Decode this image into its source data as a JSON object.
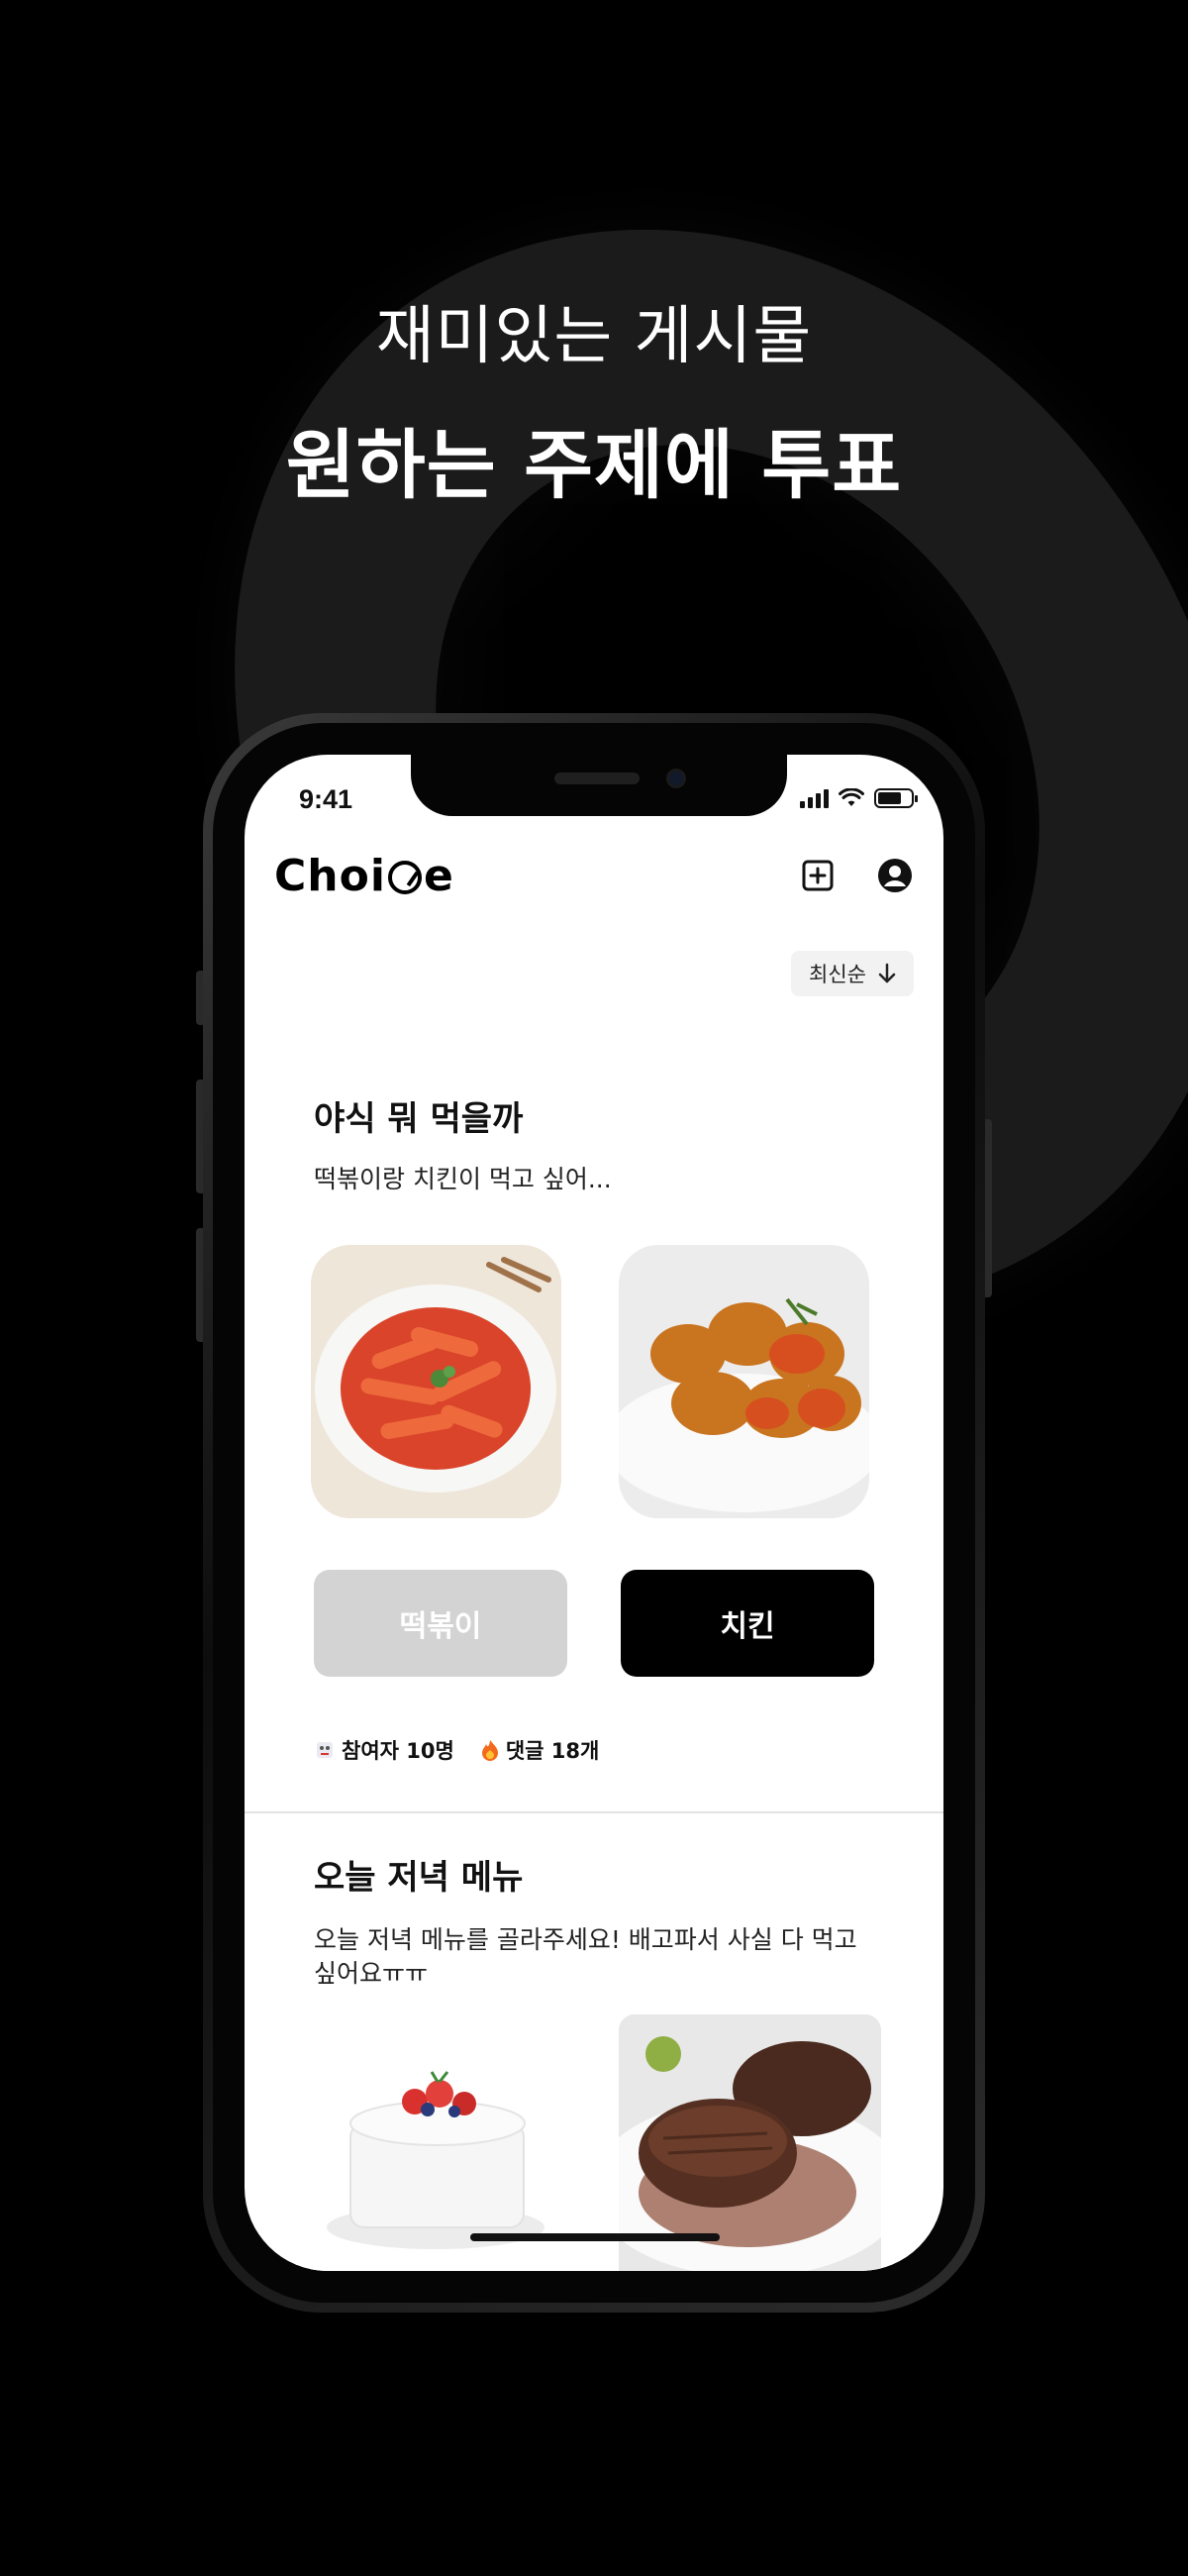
{
  "promo": {
    "line1": "재미있는 게시물",
    "line2": "원하는 주제에 투표"
  },
  "status_bar": {
    "time": "9:41"
  },
  "app": {
    "logo": {
      "part1": "Choi",
      "part2": "e"
    },
    "icons": [
      "add-post-icon",
      "profile-icon"
    ],
    "sort_label": "최신순"
  },
  "posts": [
    {
      "title": "야식 뭐 먹을까",
      "description": "떡볶이랑 치킨이 먹고 싶어...",
      "option_a": "떡볶이",
      "option_b": "치킨",
      "participants": "참여자 10명",
      "comments": "댓글 18개"
    },
    {
      "title": "오늘 저녁 메뉴",
      "description": "오늘 저녁 메뉴를 골라주세요! 배고파서 사실 다 먹고 싶어요ㅠㅠ"
    }
  ],
  "colors": {
    "background": "#000000",
    "vote_selected": "#000000",
    "vote_unselected": "#d3d3d3"
  }
}
